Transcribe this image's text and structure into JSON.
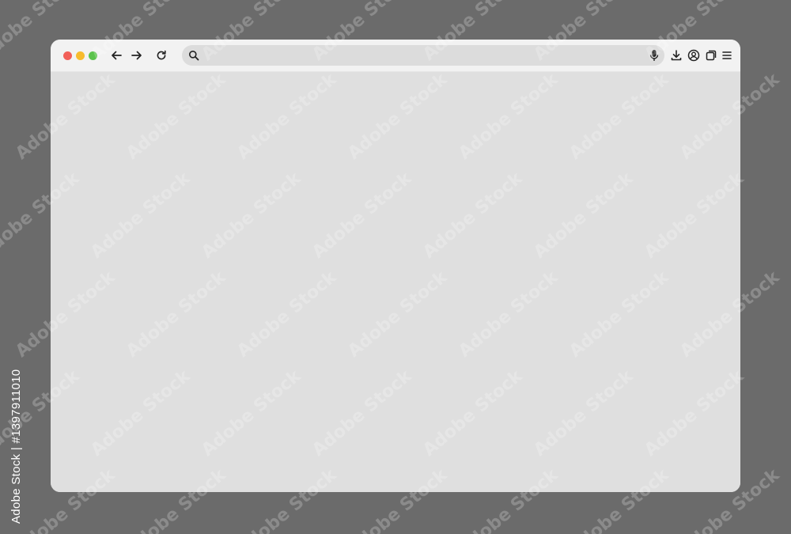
{
  "window": {
    "traffic_lights": [
      {
        "name": "close",
        "color": "#f25f58"
      },
      {
        "name": "minimize",
        "color": "#f7bb2e"
      },
      {
        "name": "maximize",
        "color": "#5bc34c"
      }
    ],
    "toolbar_icons_left": [
      "back-arrow-icon",
      "forward-arrow-icon",
      "reload-icon"
    ],
    "address_bar": {
      "value": "",
      "icon": "search-icon",
      "right_icon": "microphone-icon"
    },
    "toolbar_icons_right": [
      "download-icon",
      "profile-icon",
      "tabs-icon",
      "menu-icon"
    ]
  },
  "watermark": {
    "text": "Adobe Stock"
  },
  "credit": {
    "text": "Adobe Stock | #1397911010"
  },
  "colors": {
    "background": "#6b6b6b",
    "window": "#dfdfdf",
    "toolbar": "#f2f2f2",
    "address_bar": "#dcdcdc"
  }
}
